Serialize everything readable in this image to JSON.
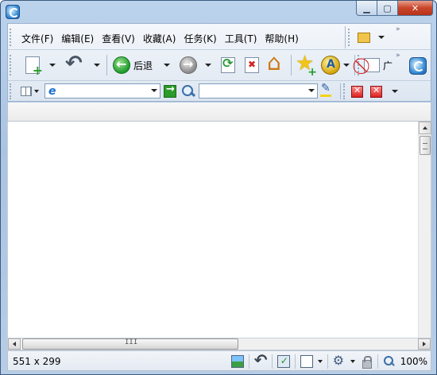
{
  "menu": {
    "items": [
      {
        "label": "文件",
        "key": "(F)"
      },
      {
        "label": "编辑",
        "key": "(E)"
      },
      {
        "label": "查看",
        "key": "(V)"
      },
      {
        "label": "收藏",
        "key": "(A)"
      },
      {
        "label": "任务",
        "key": "(K)"
      },
      {
        "label": "工具",
        "key": "(T)"
      },
      {
        "label": "帮助",
        "key": "(H)"
      }
    ]
  },
  "toolbar": {
    "back_label": "后退",
    "popup_label": "广",
    "chevron": "»"
  },
  "scrollbar": {
    "grip": "III"
  },
  "status": {
    "text": "551 x 299",
    "zoom": "100%"
  }
}
